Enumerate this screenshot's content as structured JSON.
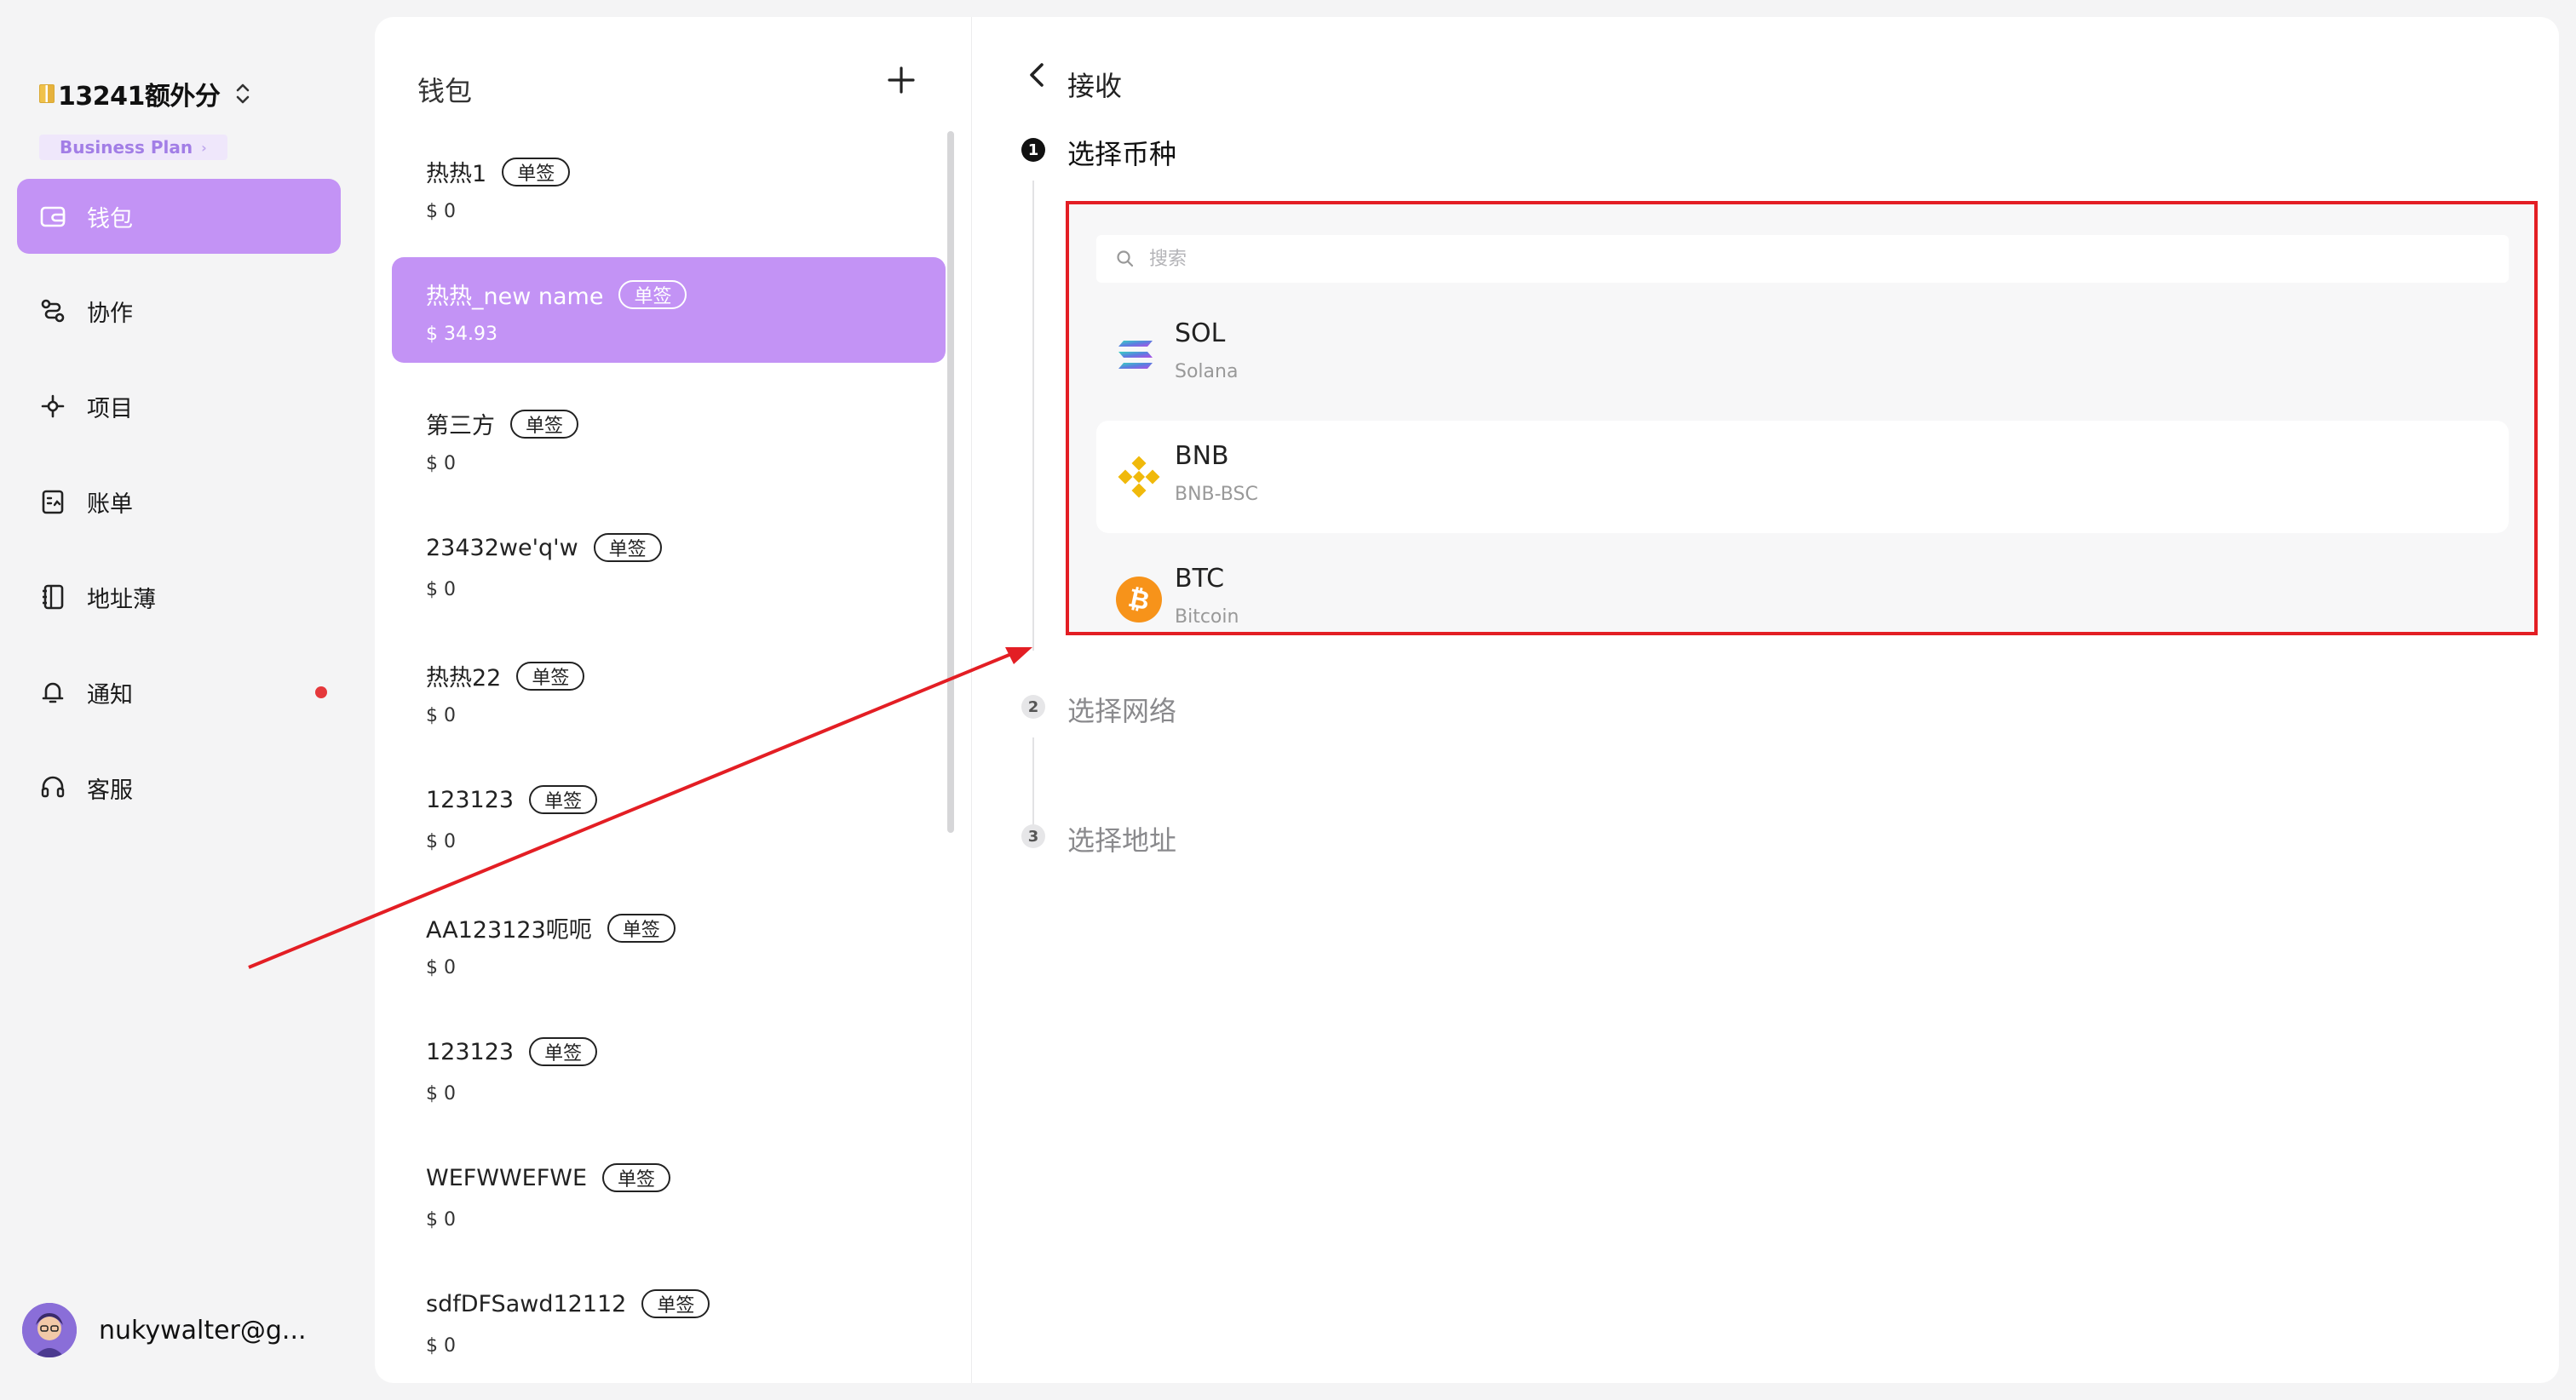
{
  "sidebar": {
    "org_name": "13241额外分",
    "plan": "Business Plan",
    "items": [
      {
        "label": "钱包",
        "icon": "wallet-icon",
        "active": true
      },
      {
        "label": "协作",
        "icon": "collaborate-icon",
        "active": false
      },
      {
        "label": "项目",
        "icon": "project-icon",
        "active": false
      },
      {
        "label": "账单",
        "icon": "bill-icon",
        "active": false
      },
      {
        "label": "地址薄",
        "icon": "address-book-icon",
        "active": false
      },
      {
        "label": "通知",
        "icon": "bell-icon",
        "active": false,
        "badge": true
      },
      {
        "label": "客服",
        "icon": "headset-icon",
        "active": false
      }
    ],
    "user_email": "nukywalter@g..."
  },
  "wallets": {
    "title": "钱包",
    "items": [
      {
        "name": "热热1",
        "tag": "单签",
        "balance": "$ 0"
      },
      {
        "name": "热热_new name",
        "tag": "单签",
        "balance": "$ 34.93"
      },
      {
        "name": "第三方",
        "tag": "单签",
        "balance": "$ 0"
      },
      {
        "name": "23432we'q'w",
        "tag": "单签",
        "balance": "$ 0"
      },
      {
        "name": "热热22",
        "tag": "单签",
        "balance": "$ 0"
      },
      {
        "name": "123123",
        "tag": "单签",
        "balance": "$ 0"
      },
      {
        "name": "AA123123呃呃",
        "tag": "单签",
        "balance": "$ 0"
      },
      {
        "name": "123123",
        "tag": "单签",
        "balance": "$ 0"
      },
      {
        "name": "WEFWWEFWE",
        "tag": "单签",
        "balance": "$ 0"
      },
      {
        "name": "sdfDFSawd12112",
        "tag": "单签",
        "balance": "$ 0"
      }
    ]
  },
  "receive": {
    "title": "接收",
    "steps": [
      {
        "num": "1",
        "label": "选择币种"
      },
      {
        "num": "2",
        "label": "选择网络"
      },
      {
        "num": "3",
        "label": "选择地址"
      }
    ],
    "search_placeholder": "搜索",
    "coins": [
      {
        "symbol": "SOL",
        "network": "Solana",
        "icon": "solana-icon"
      },
      {
        "symbol": "BNB",
        "network": "BNB-BSC",
        "icon": "bnb-icon"
      },
      {
        "symbol": "BTC",
        "network": "Bitcoin",
        "icon": "bitcoin-icon"
      }
    ]
  },
  "colors": {
    "accent": "#c393f5",
    "annotation": "#e31e24",
    "notification_dot": "#e5383b"
  }
}
